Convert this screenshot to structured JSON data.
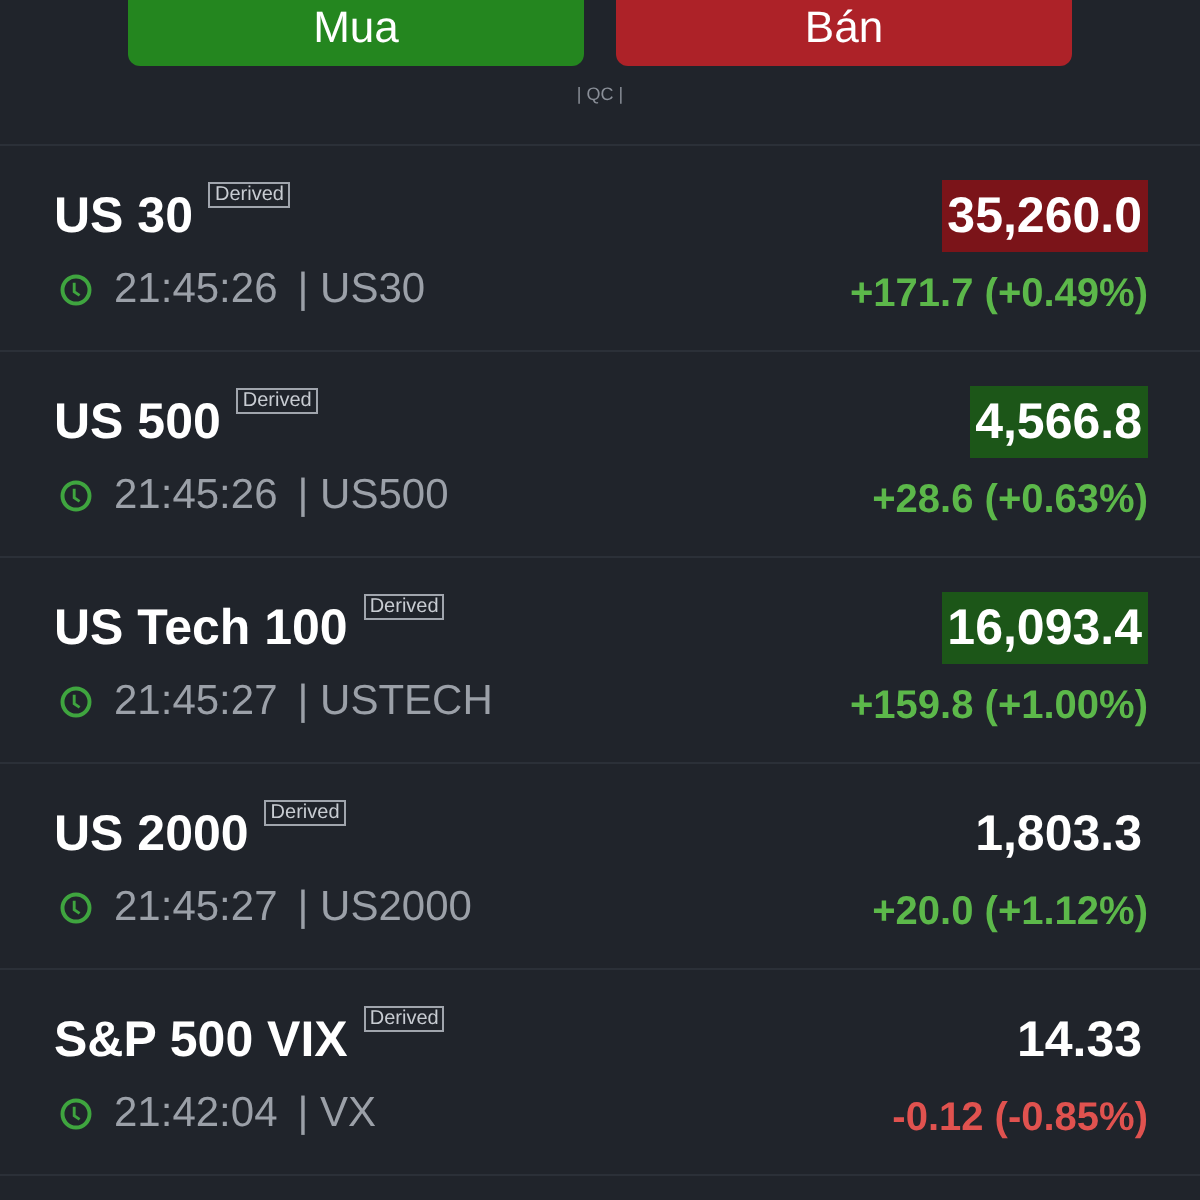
{
  "actions": [
    {
      "label": "Mua",
      "kind": "buy"
    },
    {
      "label": "Bán",
      "kind": "sell"
    }
  ],
  "ad_label": "| QC |",
  "quotes": [
    {
      "name": "US 30",
      "tag": "Derived",
      "time": "21:45:26",
      "symbol": "| US30",
      "price": {
        "text": "35,260.0",
        "highlighted": true,
        "color": "#7b1419"
      },
      "change": {
        "text": "+171.7 (+0.49%)",
        "color": "#5cb84a"
      }
    },
    {
      "name": "US 500",
      "tag": "Derived",
      "time": "21:45:26",
      "symbol": "| US500",
      "price": {
        "text": "4,566.8",
        "highlighted": true,
        "color": "#1c5618"
      },
      "change": {
        "text": "+28.6 (+0.63%)",
        "color": "#5cb84a"
      }
    },
    {
      "name": "US Tech 100",
      "tag": "Derived",
      "time": "21:45:27",
      "symbol": "| USTECH",
      "price": {
        "text": "16,093.4",
        "highlighted": true,
        "color": "#1c5618"
      },
      "change": {
        "text": "+159.8 (+1.00%)",
        "color": "#5cb84a"
      }
    },
    {
      "name": "US 2000",
      "tag": "Derived",
      "time": "21:45:27",
      "symbol": "| US2000",
      "price": {
        "text": "1,803.3",
        "highlighted": false
      },
      "change": {
        "text": "+20.0 (+1.12%)",
        "color": "#5cb84a"
      }
    },
    {
      "name": "S&P 500 VIX",
      "tag": "Derived",
      "time": "21:42:04",
      "symbol": "| VX",
      "price": {
        "text": "14.33",
        "highlighted": false
      },
      "change": {
        "text": "-0.12 (-0.85%)",
        "color": "#e0524f"
      }
    }
  ]
}
